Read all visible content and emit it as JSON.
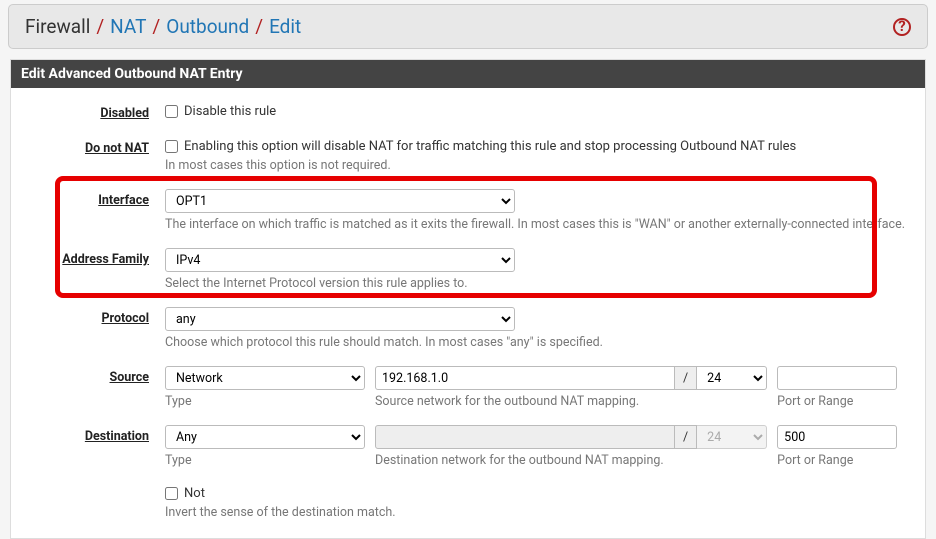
{
  "breadcrumb": {
    "crumb1": "Firewall",
    "crumb2": "NAT",
    "crumb3": "Outbound",
    "crumb4": "Edit",
    "help": "?"
  },
  "panel": {
    "title": "Edit Advanced Outbound NAT Entry"
  },
  "rows": {
    "disabled": {
      "label": "Disabled",
      "checkbox_label": "Disable this rule"
    },
    "donotnat": {
      "label": "Do not NAT",
      "checkbox_label": "Enabling this option will disable NAT for traffic matching this rule and stop processing Outbound NAT rules",
      "help": "In most cases this option is not required."
    },
    "interface": {
      "label": "Interface",
      "value": "OPT1",
      "help": "The interface on which traffic is matched as it exits the firewall. In most cases this is \"WAN\" or another externally-connected interface."
    },
    "address_family": {
      "label": "Address Family",
      "value": "IPv4",
      "help": "Select the Internet Protocol version this rule applies to."
    },
    "protocol": {
      "label": "Protocol",
      "value": "any",
      "help": "Choose which protocol this rule should match. In most cases \"any\" is specified."
    },
    "source": {
      "label": "Source",
      "type_value": "Network",
      "type_help": "Type",
      "net_value": "192.168.1.0",
      "net_help": "Source network for the outbound NAT mapping.",
      "prefix_value": "24",
      "port_value": "",
      "port_help": "Port or Range",
      "slash": "/"
    },
    "destination": {
      "label": "Destination",
      "type_value": "Any",
      "type_help": "Type",
      "net_value": "",
      "net_help": "Destination network for the outbound NAT mapping.",
      "prefix_value": "24",
      "port_value": "500",
      "port_help": "Port or Range",
      "slash": "/"
    },
    "not": {
      "checkbox_label": "Not",
      "help": "Invert the sense of the destination match."
    }
  }
}
